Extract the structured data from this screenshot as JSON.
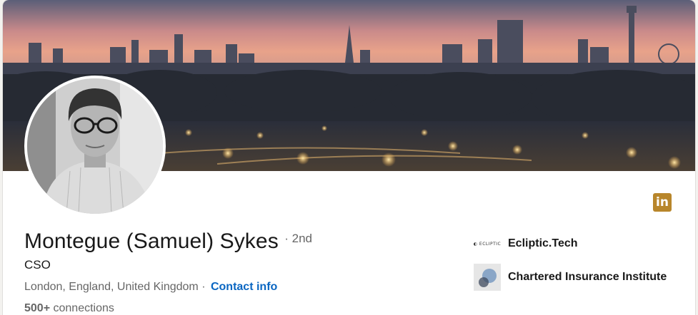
{
  "profile": {
    "name": "Montegue (Samuel) Sykes",
    "degree": "· 2nd",
    "headline": "CSO",
    "location": "London, England, United Kingdom",
    "separator": "·",
    "contact_label": "Contact info",
    "connections_count": "500+",
    "connections_label": "connections"
  },
  "badge": {
    "label": "in",
    "icon": "linkedin-icon",
    "color": "#b8862b"
  },
  "orgs": [
    {
      "name": "Ecliptic.Tech",
      "logo_text": "◐ ECLIPTIC",
      "icon": "ecliptic-logo"
    },
    {
      "name": "Chartered Insurance Institute",
      "icon": "cii-logo"
    }
  ],
  "colors": {
    "link": "#0a66c2",
    "text": "#191919",
    "muted": "#666666"
  }
}
